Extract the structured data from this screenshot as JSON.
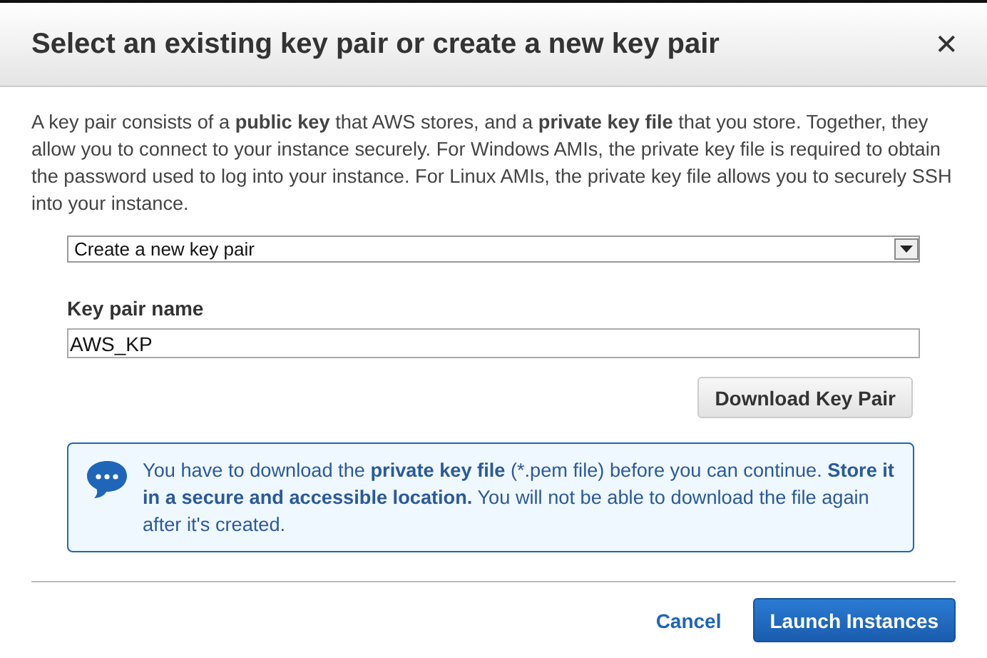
{
  "dialog": {
    "title": "Select an existing key pair or create a new key pair",
    "close": "✕"
  },
  "intro": "A key pair consists of a **public key** that AWS stores, and a **private key file** that you store. Together, they allow you to connect to your instance securely. For Windows AMIs, the private key file is required to obtain the password used to log into your instance. For Linux AMIs, the private key file allows you to securely SSH into your instance.",
  "key_pair_select": {
    "value": "Create a new key pair"
  },
  "key_pair_name": {
    "label": "Key pair name",
    "value": "AWS_KP"
  },
  "download_button": "Download Key Pair",
  "info": "You have to download the **private key file** (*.pem file) before you can continue. **Store it in a secure and accessible location.** You will not be able to download the file again after it's created.",
  "buttons": [
    {
      "label": "Cancel",
      "kind": "link"
    },
    {
      "label": "Launch Instances",
      "kind": "primary"
    }
  ]
}
